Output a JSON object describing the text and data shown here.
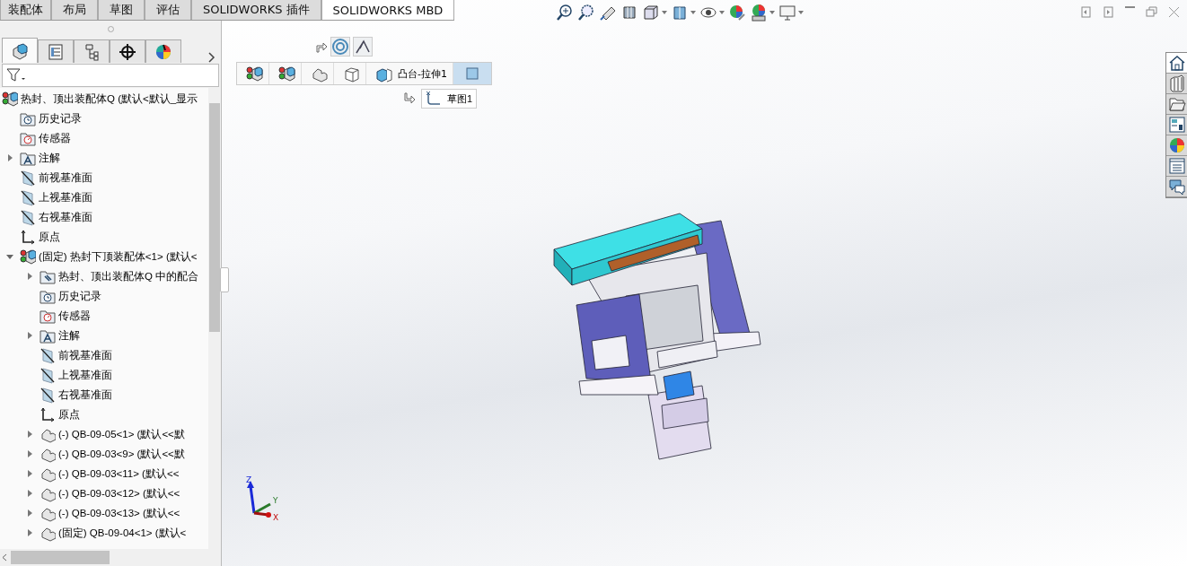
{
  "tabs": [
    {
      "label": "装配体",
      "selected": false
    },
    {
      "label": "布局",
      "selected": false
    },
    {
      "label": "草图",
      "selected": false
    },
    {
      "label": "评估",
      "selected": false
    },
    {
      "label": "SOLIDWORKS 插件",
      "selected": false
    },
    {
      "label": "SOLIDWORKS MBD",
      "selected": true
    }
  ],
  "panel_tabs": [
    {
      "kind": "feature",
      "selected": true
    },
    {
      "kind": "property",
      "selected": false
    },
    {
      "kind": "config",
      "selected": false
    },
    {
      "kind": "dimxpert",
      "selected": false
    },
    {
      "kind": "display",
      "selected": false
    }
  ],
  "tree": {
    "label": "热封、顶出装配体Q  (默认<默认_显示",
    "kind": "assembly",
    "children": [
      {
        "label": "历史记录",
        "kind": "history"
      },
      {
        "label": "传感器",
        "kind": "sensor"
      },
      {
        "label": "注解",
        "kind": "annotation",
        "expanded": false
      },
      {
        "label": "前视基准面",
        "kind": "plane"
      },
      {
        "label": "上视基准面",
        "kind": "plane"
      },
      {
        "label": "右视基准面",
        "kind": "plane"
      },
      {
        "label": "原点",
        "kind": "origin"
      },
      {
        "label": "(固定) 热封下顶装配体<1> (默认<",
        "kind": "assembly",
        "expanded": true,
        "children": [
          {
            "label": "热封、顶出装配体Q 中的配合",
            "kind": "mates",
            "expanded": false
          },
          {
            "label": "历史记录",
            "kind": "history"
          },
          {
            "label": "传感器",
            "kind": "sensor"
          },
          {
            "label": "注解",
            "kind": "annotation",
            "expanded": false
          },
          {
            "label": "前视基准面",
            "kind": "plane"
          },
          {
            "label": "上视基准面",
            "kind": "plane"
          },
          {
            "label": "右视基准面",
            "kind": "plane"
          },
          {
            "label": "原点",
            "kind": "origin"
          },
          {
            "label": "(-) QB-09-05<1> (默认<<默",
            "kind": "part",
            "expanded": false
          },
          {
            "label": "(-) QB-09-03<9> (默认<<默",
            "kind": "part",
            "expanded": false
          },
          {
            "label": "(-) QB-09-03<11> (默认<<",
            "kind": "part",
            "expanded": false
          },
          {
            "label": "(-) QB-09-03<12> (默认<<",
            "kind": "part",
            "expanded": false
          },
          {
            "label": "(-) QB-09-03<13> (默认<<",
            "kind": "part",
            "expanded": false
          },
          {
            "label": "(固定) QB-09-04<1> (默认<",
            "kind": "part",
            "expanded": false
          }
        ]
      }
    ]
  },
  "breadcrumb": {
    "items": [
      {
        "kind": "assembly"
      },
      {
        "kind": "assembly"
      },
      {
        "kind": "part"
      },
      {
        "kind": "body"
      },
      {
        "kind": "feature"
      }
    ],
    "feature_label": "凸台-拉伸1",
    "sketch_label": "草图1"
  },
  "triad": {
    "z": "Z",
    "y": "Y",
    "x": "X"
  }
}
